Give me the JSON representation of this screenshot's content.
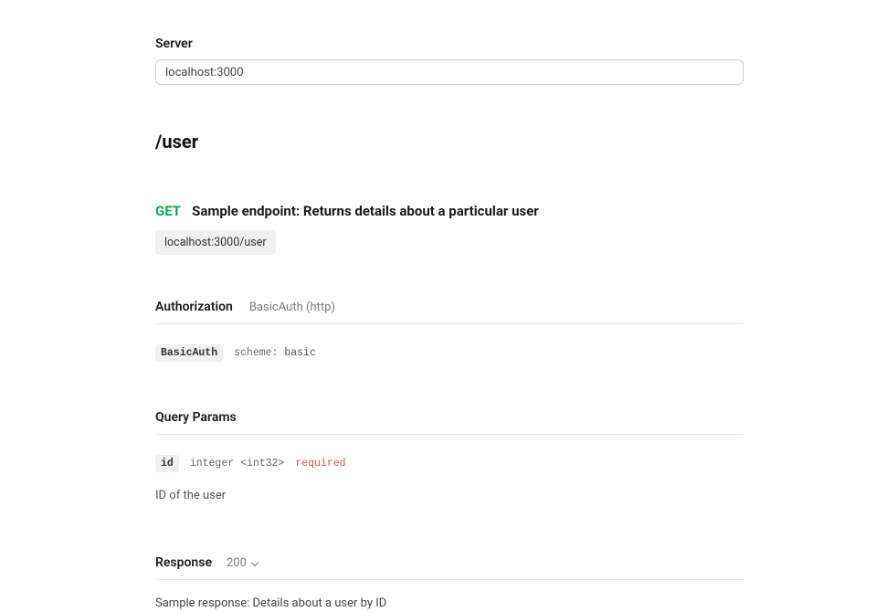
{
  "server": {
    "label": "Server",
    "value": "localhost:3000"
  },
  "path": "/user",
  "endpoint": {
    "method": "GET",
    "title": "Sample endpoint: Returns details about a particular user",
    "url": "localhost:3000/user"
  },
  "authorization": {
    "title": "Authorization",
    "subtitle": "BasicAuth (http)",
    "scheme_name": "BasicAuth",
    "scheme_key": "scheme:",
    "scheme_value": "basic"
  },
  "queryParams": {
    "title": "Query Params",
    "items": [
      {
        "name": "id",
        "type": "integer <int32>",
        "requiredLabel": "required",
        "description": "ID of the user"
      }
    ]
  },
  "response": {
    "title": "Response",
    "code": "200",
    "description": "Sample response: Details about a user by ID"
  }
}
